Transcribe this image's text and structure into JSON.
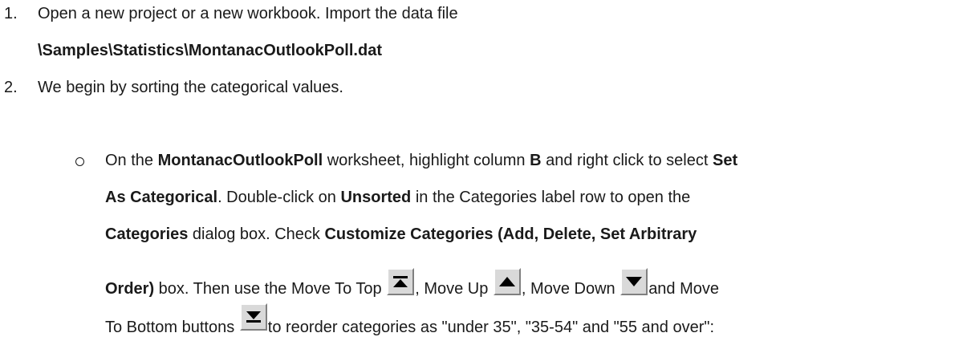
{
  "steps": [
    {
      "number": "1.",
      "line1": "Open a new project or a new workbook. Import the data file",
      "path": "\\Samples\\Statistics\\MontanacOutlookPoll.dat"
    },
    {
      "number": "2.",
      "line1": "We begin by sorting the categorical values."
    }
  ],
  "bullet": {
    "l1": [
      "On the ",
      "MontanacOutlookPoll",
      " worksheet, highlight column ",
      "B",
      " and right click to select ",
      "Set"
    ],
    "l2": [
      "As Categorical",
      ". Double-click on ",
      "Unsorted",
      " in the Categories label row to open the"
    ],
    "l3": [
      "Categories",
      " dialog box. Check ",
      "Customize Categories (Add, Delete, Set Arbitrary"
    ],
    "l4": [
      "Order)",
      " box. Then use the Move To Top ",
      ", Move Up ",
      ", Move Down ",
      "and Move"
    ],
    "l5": [
      "To Bottom buttons ",
      "to reorder categories as \"under 35\", \"35-54\" and \"55 and over\":"
    ]
  },
  "icons": [
    "move-to-top-icon",
    "move-up-icon",
    "move-down-icon",
    "move-to-bottom-icon"
  ]
}
